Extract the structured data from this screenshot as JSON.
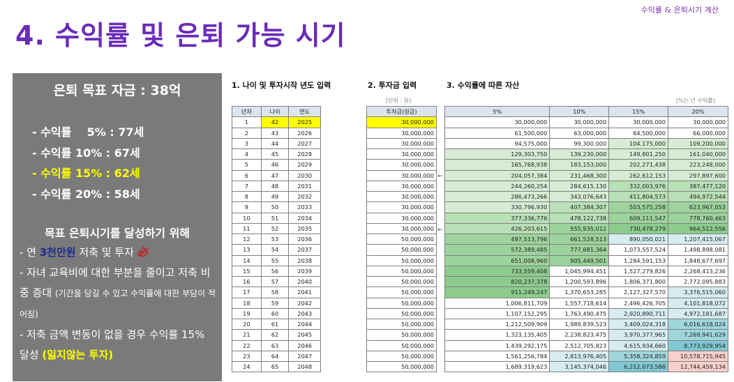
{
  "header_tag": "수익률 & 은퇴시기 계산",
  "page_title": "4. 수익률 및 은퇴 가능 시기",
  "summary": {
    "title": "은퇴 목표 자금 : 38억",
    "rates": [
      {
        "text": "- 수익률    5% : 77세",
        "highlight": false
      },
      {
        "text": "- 수익률 10% : 67세",
        "highlight": false
      },
      {
        "text": "- 수익률 15% : 62세",
        "highlight": true
      },
      {
        "text": "- 수익률 20% : 58세",
        "highlight": false
      }
    ],
    "goal_heading": "목표 은퇴시기를 달성하기 위해",
    "goal_line1_prefix": "- 연 ",
    "goal_line1_accent": "3천만원",
    "goal_line1_suffix": " 저축 및 투자 ",
    "goal_line1_must": "必",
    "goal_line2": "- 자녀 교육비에 대한 부분을 줄이고 저축 비중 증대 ",
    "goal_line2_small": "(기간을 당길 수 있고 수익률에 대한 부담이 적어짐)",
    "goal_line3": "- 저축 금액 변동이 없을 경우 수익률 15% 달성 ",
    "goal_line3_bold": "(잃지않는 투자)"
  },
  "sections": {
    "age_input": "1. 나이 및 투자시작 년도 입력",
    "invest_input": "2. 투자금 입력",
    "asset_by_rate": "3. 수익률에 따른 자산"
  },
  "notes": {
    "unit": "[단위 : 원]",
    "rate_note": "[%는 년 수익률]"
  },
  "age_table": {
    "headers": [
      "년차",
      "나이",
      "연도"
    ],
    "rows": [
      [
        "1",
        "42",
        "2025"
      ],
      [
        "2",
        "43",
        "2026"
      ],
      [
        "3",
        "44",
        "2027"
      ],
      [
        "4",
        "45",
        "2028"
      ],
      [
        "5",
        "46",
        "2029"
      ],
      [
        "6",
        "47",
        "2030"
      ],
      [
        "7",
        "48",
        "2031"
      ],
      [
        "8",
        "49",
        "2032"
      ],
      [
        "9",
        "50",
        "2033"
      ],
      [
        "10",
        "51",
        "2034"
      ],
      [
        "11",
        "52",
        "2035"
      ],
      [
        "12",
        "53",
        "2036"
      ],
      [
        "13",
        "54",
        "2037"
      ],
      [
        "14",
        "55",
        "2038"
      ],
      [
        "15",
        "56",
        "2039"
      ],
      [
        "16",
        "57",
        "2040"
      ],
      [
        "17",
        "58",
        "2041"
      ],
      [
        "18",
        "59",
        "2042"
      ],
      [
        "19",
        "60",
        "2043"
      ],
      [
        "20",
        "61",
        "2044"
      ],
      [
        "21",
        "62",
        "2045"
      ],
      [
        "22",
        "63",
        "2046"
      ],
      [
        "23",
        "64",
        "2047"
      ],
      [
        "24",
        "65",
        "2048"
      ]
    ]
  },
  "invest_table": {
    "header": "투자금(원금)",
    "rows": [
      "30,000,000",
      "30,000,000",
      "30,000,000",
      "30,000,000",
      "30,000,000",
      "30,000,000",
      "30,000,000",
      "30,000,000",
      "30,000,000",
      "30,000,000",
      "30,000,000",
      "50,000,000",
      "50,000,000",
      "50,000,000",
      "50,000,000",
      "50,000,000",
      "50,000,000",
      "50,000,000",
      "50,000,000",
      "50,000,000",
      "50,000,000",
      "50,000,000",
      "50,000,000",
      "50,000,000"
    ]
  },
  "asset_table": {
    "headers": [
      "5%",
      "10%",
      "15%",
      "20%"
    ],
    "rows": [
      [
        "30,000,000",
        "30,000,000",
        "30,000,000",
        "30,000,000"
      ],
      [
        "61,500,000",
        "63,000,000",
        "64,500,000",
        "66,000,000"
      ],
      [
        "94,575,000",
        "99,300,000",
        "104,175,000",
        "109,200,000"
      ],
      [
        "129,303,750",
        "139,230,000",
        "149,801,250",
        "161,040,000"
      ],
      [
        "165,768,938",
        "183,153,000",
        "202,271,438",
        "223,248,000"
      ],
      [
        "204,057,384",
        "231,468,300",
        "262,612,153",
        "297,897,600"
      ],
      [
        "244,260,254",
        "284,615,130",
        "332,003,976",
        "387,477,120"
      ],
      [
        "286,473,266",
        "343,076,643",
        "411,804,573",
        "494,972,544"
      ],
      [
        "330,796,930",
        "407,384,307",
        "503,575,258",
        "623,967,053"
      ],
      [
        "377,336,776",
        "478,122,738",
        "609,111,547",
        "778,760,463"
      ],
      [
        "426,203,615",
        "555,935,012",
        "730,478,279",
        "964,512,556"
      ],
      [
        "497,513,796",
        "661,528,513",
        "890,050,021",
        "1,207,415,067"
      ],
      [
        "572,389,485",
        "777,681,364",
        "1,073,557,524",
        "1,498,898,081"
      ],
      [
        "651,008,960",
        "905,449,501",
        "1,284,591,153",
        "1,848,677,697"
      ],
      [
        "733,559,408",
        "1,045,994,451",
        "1,527,279,826",
        "2,268,413,236"
      ],
      [
        "820,237,378",
        "1,200,593,896",
        "1,806,371,800",
        "2,772,095,883"
      ],
      [
        "911,249,247",
        "1,370,653,285",
        "2,127,327,570",
        "3,376,515,060"
      ],
      [
        "1,006,811,709",
        "1,557,718,614",
        "2,496,426,705",
        "4,101,818,072"
      ],
      [
        "1,107,152,295",
        "1,763,490,475",
        "2,920,890,711",
        "4,972,181,687"
      ],
      [
        "1,212,509,909",
        "1,989,839,523",
        "3,409,024,318",
        "6,016,618,024"
      ],
      [
        "1,323,135,405",
        "2,238,823,475",
        "3,970,377,965",
        "7,269,941,629"
      ],
      [
        "1,439,292,175",
        "2,512,705,823",
        "4,615,934,660",
        "8,773,929,954"
      ],
      [
        "1,561,256,784",
        "2,813,976,405",
        "5,358,324,859",
        "10,578,715,945"
      ],
      [
        "1,689,319,623",
        "3,145,374,046",
        "6,212,073,588",
        "12,744,459,134"
      ]
    ],
    "colors": [
      [
        "#ffffff",
        "#ffffff",
        "#ffffff",
        "#ffffff"
      ],
      [
        "#ffffff",
        "#ffffff",
        "#ffffff",
        "#ffffff"
      ],
      [
        "#ffffff",
        "#ffffff",
        "#d6ecd4",
        "#d6ecd4"
      ],
      [
        "#d6ecd4",
        "#d6ecd4",
        "#d6ecd4",
        "#d6ecd4"
      ],
      [
        "#d6ecd4",
        "#d6ecd4",
        "#d6ecd4",
        "#d6ecd4"
      ],
      [
        "#d6ecd4",
        "#d6ecd4",
        "#d6ecd4",
        "#d6ecd4"
      ],
      [
        "#d6ecd4",
        "#d6ecd4",
        "#b9e0b7",
        "#b9e0b7"
      ],
      [
        "#d6ecd4",
        "#d6ecd4",
        "#b9e0b7",
        "#b9e0b7"
      ],
      [
        "#d6ecd4",
        "#b9e0b7",
        "#9dd39c",
        "#9dd39c"
      ],
      [
        "#b9e0b7",
        "#b9e0b7",
        "#9dd39c",
        "#9dd39c"
      ],
      [
        "#b9e0b7",
        "#9dd39c",
        "#8dcc8e",
        "#8dcc8e"
      ],
      [
        "#9dd39c",
        "#9dd39c",
        "#d6ecf0",
        "#d6ecf0"
      ],
      [
        "#9dd39c",
        "#9dd39c",
        "#ffffff",
        "#ffffff"
      ],
      [
        "#9dd39c",
        "#9dd39c",
        "#ffffff",
        "#ffffff"
      ],
      [
        "#8dcc8e",
        "#ffffff",
        "#ffffff",
        "#ffffff"
      ],
      [
        "#8dcc8e",
        "#ffffff",
        "#ffffff",
        "#ffffff"
      ],
      [
        "#8dcc8e",
        "#ffffff",
        "#ffffff",
        "#d6ecf0"
      ],
      [
        "#ffffff",
        "#ffffff",
        "#ffffff",
        "#d6ecf0"
      ],
      [
        "#ffffff",
        "#ffffff",
        "#d6ecf0",
        "#d6ecf0"
      ],
      [
        "#ffffff",
        "#ffffff",
        "#d6ecf0",
        "#9fd6dc"
      ],
      [
        "#ffffff",
        "#ffffff",
        "#d6ecf0",
        "#9fd6dc"
      ],
      [
        "#ffffff",
        "#ffffff",
        "#d6ecf0",
        "#7fc8d2"
      ],
      [
        "#ffffff",
        "#d6ecf0",
        "#9fd6dc",
        "#f8d0cb"
      ],
      [
        "#ffffff",
        "#d6ecf0",
        "#7fc8d2",
        "#f8d0cb"
      ]
    ]
  },
  "arrow_rows": [
    6,
    11
  ],
  "arrow_glyph": "←"
}
